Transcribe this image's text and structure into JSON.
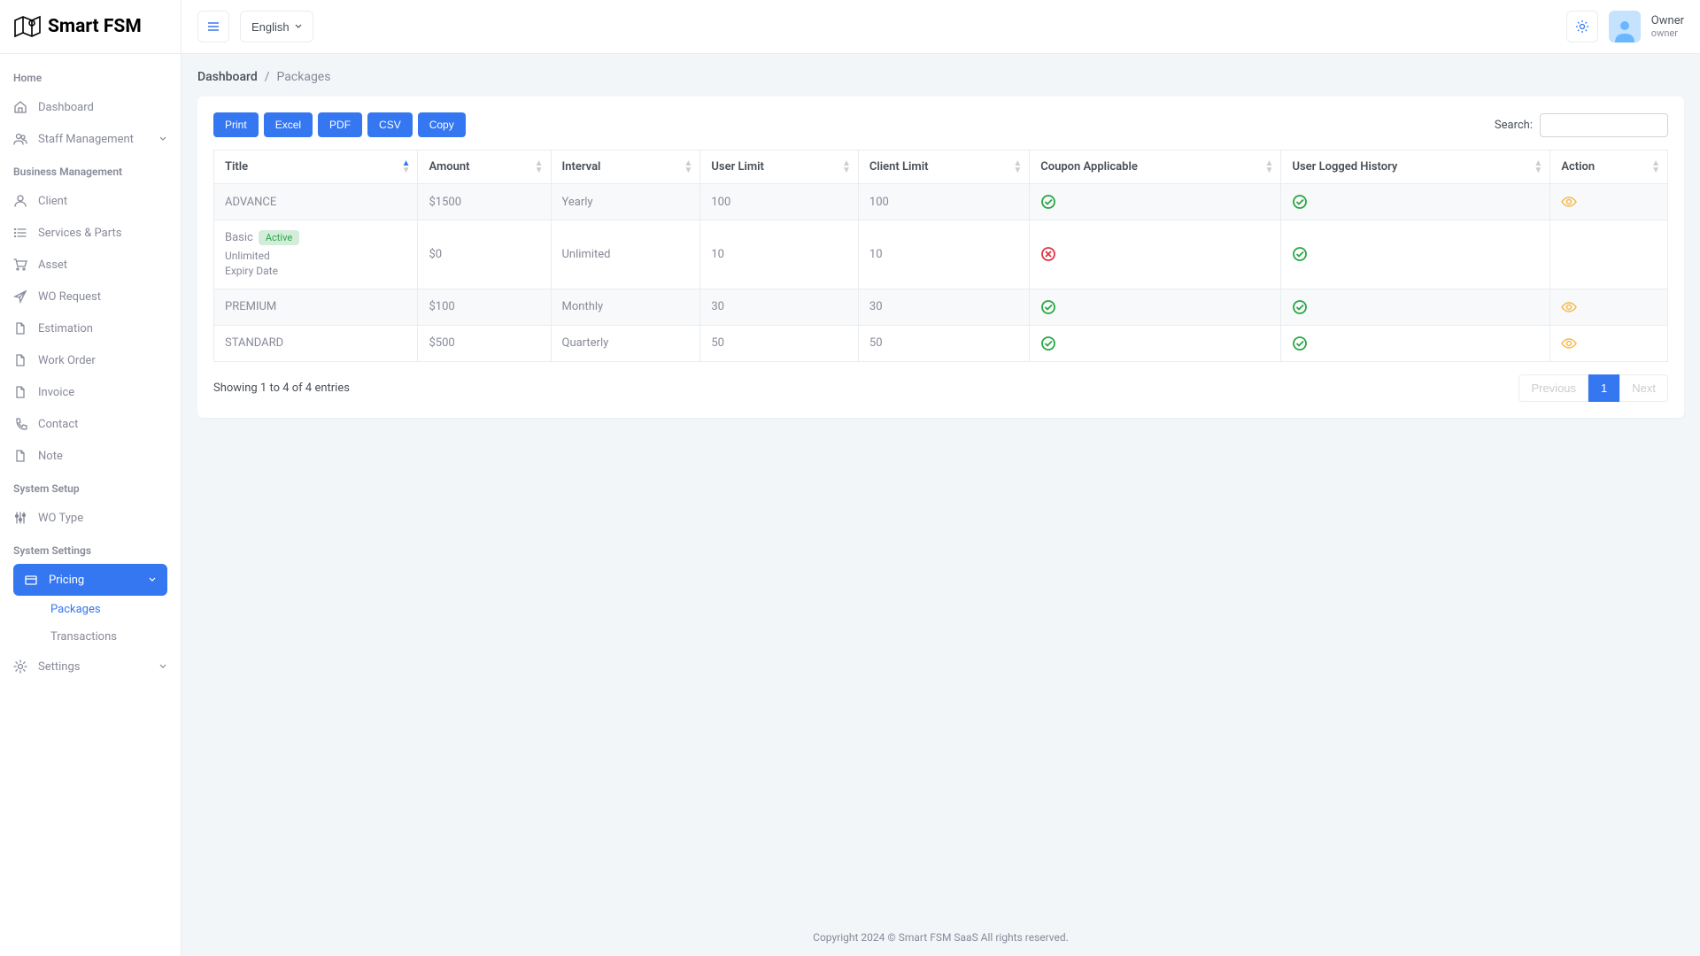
{
  "logo_text": "Smart FSM",
  "topbar": {
    "language": "English",
    "user_name": "Owner",
    "user_role": "owner"
  },
  "sidebar": {
    "sections": [
      {
        "header": "Home",
        "items": [
          {
            "label": "Dashboard",
            "icon": "home"
          },
          {
            "label": "Staff Management",
            "icon": "users",
            "chevron": true
          }
        ]
      },
      {
        "header": "Business Management",
        "items": [
          {
            "label": "Client",
            "icon": "user"
          },
          {
            "label": "Services & Parts",
            "icon": "list"
          },
          {
            "label": "Asset",
            "icon": "cart"
          },
          {
            "label": "WO Request",
            "icon": "send"
          },
          {
            "label": "Estimation",
            "icon": "file"
          },
          {
            "label": "Work Order",
            "icon": "file"
          },
          {
            "label": "Invoice",
            "icon": "file"
          },
          {
            "label": "Contact",
            "icon": "phone"
          },
          {
            "label": "Note",
            "icon": "file"
          }
        ]
      },
      {
        "header": "System Setup",
        "items": [
          {
            "label": "WO Type",
            "icon": "sliders"
          }
        ]
      },
      {
        "header": "System Settings",
        "items": [
          {
            "label": "Pricing",
            "icon": "card",
            "chevron": true,
            "active": true,
            "children": [
              {
                "label": "Packages",
                "current": true
              },
              {
                "label": "Transactions"
              }
            ]
          },
          {
            "label": "Settings",
            "icon": "gear",
            "chevron": true
          }
        ]
      }
    ]
  },
  "breadcrumb": {
    "root": "Dashboard",
    "leaf": "Packages"
  },
  "export_buttons": [
    "Print",
    "Excel",
    "PDF",
    "CSV",
    "Copy"
  ],
  "search_label": "Search:",
  "columns": [
    "Title",
    "Amount",
    "Interval",
    "User Limit",
    "Client Limit",
    "Coupon Applicable",
    "User Logged History",
    "Action"
  ],
  "rows": [
    {
      "title": "ADVANCE",
      "amount": "$1500",
      "interval": "Yearly",
      "user_limit": "100",
      "client_limit": "100",
      "coupon": true,
      "history": true,
      "eye": true
    },
    {
      "title": "Basic",
      "badge": "Active",
      "sub1": "Unlimited",
      "sub2": "Expiry Date",
      "amount": "$0",
      "interval": "Unlimited",
      "user_limit": "10",
      "client_limit": "10",
      "coupon": false,
      "history": true,
      "eye": false
    },
    {
      "title": "PREMIUM",
      "amount": "$100",
      "interval": "Monthly",
      "user_limit": "30",
      "client_limit": "30",
      "coupon": true,
      "history": true,
      "eye": true
    },
    {
      "title": "STANDARD",
      "amount": "$500",
      "interval": "Quarterly",
      "user_limit": "50",
      "client_limit": "50",
      "coupon": true,
      "history": true,
      "eye": true
    }
  ],
  "entries_text": "Showing 1 to 4 of 4 entries",
  "pagination": {
    "previous": "Previous",
    "next": "Next",
    "pages": [
      "1"
    ]
  },
  "footer": "Copyright 2024 © Smart FSM SaaS All rights reserved."
}
